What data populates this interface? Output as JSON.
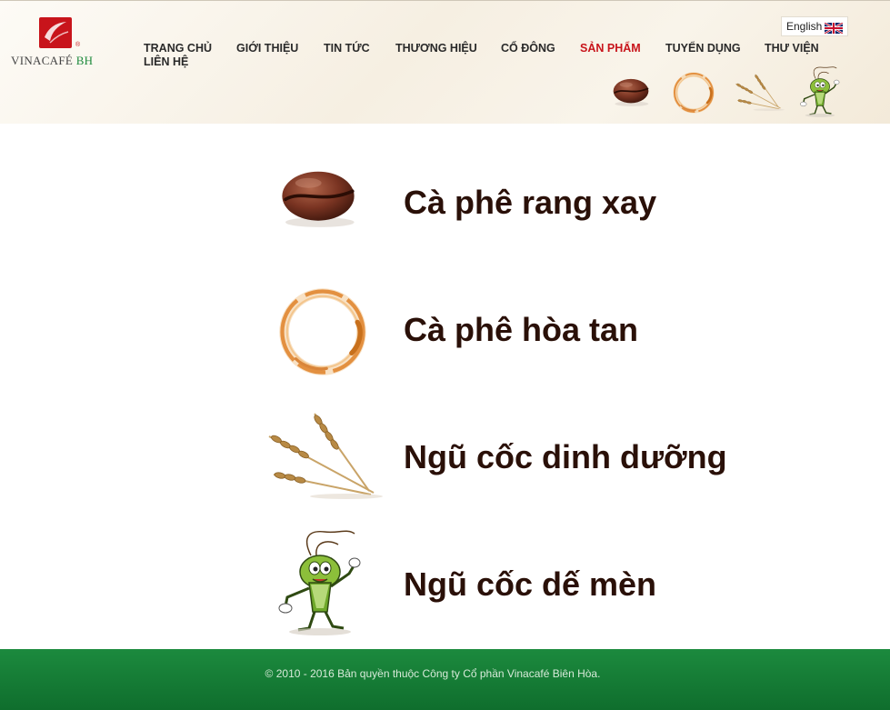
{
  "brand": {
    "name": "VINACAFÉ",
    "suffix": "BH",
    "registered_mark": "®"
  },
  "colors": {
    "brand_red": "#c8141b",
    "brand_green": "#1e8a3c",
    "product_text": "#2a1008",
    "footer_green": "#148036"
  },
  "nav": {
    "items": [
      {
        "label": "TRANG CHỦ",
        "active": false
      },
      {
        "label": "GIỚI THIỆU",
        "active": false
      },
      {
        "label": "TIN TỨC",
        "active": false
      },
      {
        "label": "THƯƠNG HIỆU",
        "active": false
      },
      {
        "label": "CỔ ĐÔNG",
        "active": false
      },
      {
        "label": "SẢN PHẨM",
        "active": true
      },
      {
        "label": "TUYỂN DỤNG",
        "active": false
      },
      {
        "label": "THƯ VIỆN",
        "active": false
      },
      {
        "label": "LIÊN HỆ",
        "active": false
      }
    ]
  },
  "language": {
    "label": "English",
    "icon": "uk-flag-icon"
  },
  "header_thumbnails": [
    {
      "icon": "coffee-bean-icon"
    },
    {
      "icon": "coffee-ring-icon"
    },
    {
      "icon": "wheat-icon"
    },
    {
      "icon": "cricket-mascot-icon"
    }
  ],
  "products": [
    {
      "label": "Cà phê rang xay",
      "icon": "coffee-bean-icon"
    },
    {
      "label": "Cà phê hòa tan",
      "icon": "coffee-ring-icon"
    },
    {
      "label": "Ngũ cốc dinh dưỡng",
      "icon": "wheat-icon"
    },
    {
      "label": "Ngũ cốc dế mèn",
      "icon": "cricket-mascot-icon"
    }
  ],
  "footer": {
    "copyright": "© 2010 - 2016 Bản quyền thuộc Công ty Cổ phần Vinacafé Biên Hòa."
  }
}
